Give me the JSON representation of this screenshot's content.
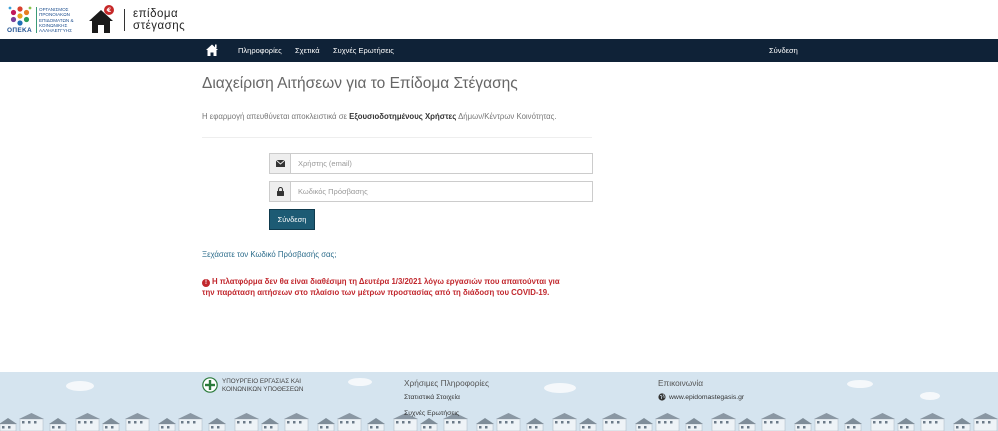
{
  "header": {
    "org_short": "ΟΠΕΚΑ",
    "org_lines": [
      "ΟΡΓΑΝΙΣΜΟΣ",
      "ΠΡΟΝΟΙΑΚΩΝ",
      "ΕΠΙΔΟΜΑΤΩΝ &",
      "ΚΟΙΝΩΝΙΚΗΣ",
      "ΑΛΛΗΛΕΓΓΥΗΣ"
    ],
    "brand_line1": "επίδομα",
    "brand_line2": "στέγασης"
  },
  "nav": {
    "items": [
      "Πληροφορίες",
      "Σχετικά",
      "Συχνές Ερωτήσεις"
    ],
    "login": "Σύνδεση"
  },
  "main": {
    "title": "Διαχείριση Αιτήσεων για το Επίδομα Στέγασης",
    "intro_pre": "Η εφαρμογή απευθύνεται αποκλειστικά σε ",
    "intro_bold": "Εξουσιοδοτημένους Χρήστες",
    "intro_post": " Δήμων/Κέντρων Κοινότητας.",
    "username_placeholder": "Χρήστης (email)",
    "password_placeholder": "Κωδικός Πρόσβασης",
    "login_button": "Σύνδεση",
    "forgot_link": "Ξεχάσατε τον Κωδικό Πρόσβασής σας;",
    "alert_icon": "!",
    "alert_line1": "Η πλατφόρμα δεν θα είναι διαθέσιμη τη Δευτέρα 1/3/2021 λόγω εργασιών που απαιτούνται για",
    "alert_line2": "την παράταση αιτήσεων στο πλαίσιο των μέτρων προστασίας από τη διάδοση του COVID-19."
  },
  "footer": {
    "ministry_line1": "ΥΠΟΥΡΓΕΙΟ ΕΡΓΑΣΙΑΣ ΚΑΙ",
    "ministry_line2": "ΚΟΙΝΩΝΙΚΩΝ ΥΠΟΘΕΣΕΩΝ",
    "useful_title": "Χρήσιμες Πληροφορίες",
    "useful_links": [
      "Στατιστικά Στοιχεία",
      "Συχνές Ερωτήσεις"
    ],
    "contact_title": "Επικοινωνία",
    "contact_site": "www.epidomastegasis.gr"
  },
  "colors": {
    "navbar": "#0f2237",
    "button": "#1d5b74",
    "alert": "#c1272d",
    "footer_bg": "#d5e4ef"
  }
}
